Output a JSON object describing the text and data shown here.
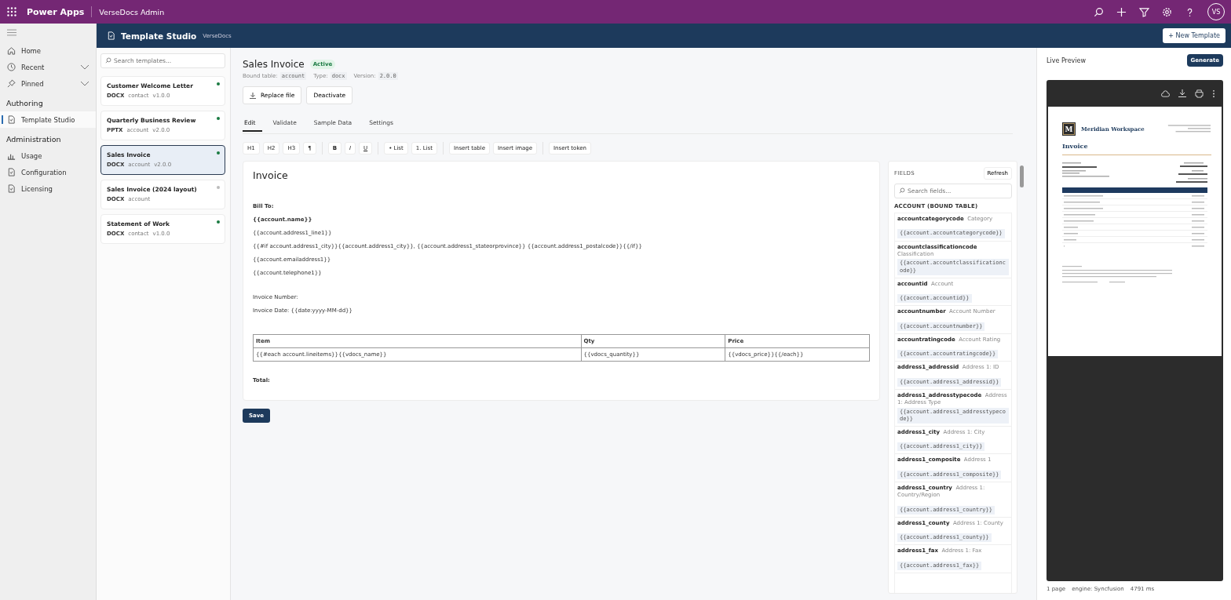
{
  "top_bar": {
    "app_name": "Power Apps",
    "environment": "VerseDocs Admin",
    "user_initials": "VS"
  },
  "nav": {
    "sections": [
      {
        "items": [
          {
            "label": "Home",
            "expandable": false,
            "selected": false
          },
          {
            "label": "Recent",
            "expandable": true,
            "selected": false
          },
          {
            "label": "Pinned",
            "expandable": true,
            "selected": false
          }
        ]
      },
      {
        "heading": "Authoring",
        "items": [
          {
            "label": "Template Studio",
            "expandable": false,
            "selected": true
          }
        ]
      },
      {
        "heading": "Administration",
        "items": [
          {
            "label": "Usage",
            "expandable": false,
            "selected": false
          },
          {
            "label": "Configuration",
            "expandable": false,
            "selected": false
          },
          {
            "label": "Licensing",
            "expandable": false,
            "selected": false
          }
        ]
      }
    ]
  },
  "studio_header": {
    "title": "Template Studio",
    "subtitle": "VerseDocs",
    "new_button": "+ New Template"
  },
  "templates": {
    "search_placeholder": "Search templates...",
    "items": [
      {
        "name": "Customer Welcome Letter",
        "format": "DOCX",
        "table": "contact",
        "version": "v1.0.0",
        "active": true,
        "selected": false
      },
      {
        "name": "Quarterly Business Review",
        "format": "PPTX",
        "table": "account",
        "version": "v2.0.0",
        "active": true,
        "selected": false
      },
      {
        "name": "Sales Invoice",
        "format": "DOCX",
        "table": "account",
        "version": "v2.0.0",
        "active": true,
        "selected": true
      },
      {
        "name": "Sales Invoice (2024 layout)",
        "format": "DOCX",
        "table": "account",
        "active": false,
        "selected": false
      },
      {
        "name": "Statement of Work",
        "format": "DOCX",
        "table": "contact",
        "version": "v1.0.0",
        "active": true,
        "selected": false
      }
    ]
  },
  "editor": {
    "title": "Sales Invoice",
    "status": "Active",
    "meta": [
      {
        "label": "Bound table:",
        "value": "account"
      },
      {
        "label": "Type:",
        "value": "docx"
      },
      {
        "label": "Version:",
        "value": "2.0.0"
      }
    ],
    "actions": [
      "Replace file",
      "Deactivate"
    ],
    "tabs": [
      {
        "label": "Edit",
        "selected": true
      },
      {
        "label": "Validate",
        "selected": false
      },
      {
        "label": "Sample Data",
        "selected": false
      },
      {
        "label": "Settings",
        "selected": false
      }
    ],
    "toolbar": [
      [
        "H1",
        "H2",
        "H3",
        "¶"
      ],
      [
        "B",
        "I",
        "U"
      ],
      [
        "• List",
        "1. List"
      ],
      [
        "Insert table",
        "Insert image"
      ],
      [
        "Insert token"
      ]
    ],
    "document": {
      "heading": "Invoice",
      "blocks": [
        {
          "kind": "gap"
        },
        {
          "kind": "bold",
          "text": "Bill To:"
        },
        {
          "kind": "bold",
          "text": "{{account.name}}"
        },
        {
          "kind": "plain",
          "text": "{{account.address1_line1}}"
        },
        {
          "kind": "plain",
          "text": "{{#if account.address1_city}}{{account.address1_city}}, {{account.address1_stateorprovince}} {{account.address1_postalcode}}{{/if}}"
        },
        {
          "kind": "plain",
          "text": "{{account.emailaddress1}}"
        },
        {
          "kind": "plain",
          "text": "{{account.telephone1}}"
        },
        {
          "kind": "gap"
        },
        {
          "kind": "plain",
          "text": "Invoice Number:"
        },
        {
          "kind": "plain",
          "text": "Invoice Date: {{date:yyyy-MM-dd}}"
        },
        {
          "kind": "gap"
        },
        {
          "kind": "table",
          "columns": [
            "Item",
            "Qty",
            "Price"
          ],
          "rows": [
            [
              "{{#each account.lineitems}}{{vdocs_name}}",
              "{{vdocs_quantity}}",
              "{{vdocs_price}}{{/each}}"
            ]
          ]
        },
        {
          "kind": "gap"
        },
        {
          "kind": "bold",
          "text": "Total:"
        }
      ]
    },
    "save": "Save"
  },
  "fields": {
    "title": "FIELDS",
    "refresh": "Refresh",
    "search_placeholder": "Search fields...",
    "group": "ACCOUNT (BOUND TABLE)",
    "items": [
      {
        "name": "accountcategorycode",
        "label": "Category",
        "token": "{{account.accountcategorycode}}"
      },
      {
        "name": "accountclassificationcode",
        "label": "Classification",
        "token": "{{account.accountclassificationcode}}"
      },
      {
        "name": "accountid",
        "label": "Account",
        "token": "{{account.accountid}}"
      },
      {
        "name": "accountnumber",
        "label": "Account Number",
        "token": "{{account.accountnumber}}"
      },
      {
        "name": "accountratingcode",
        "label": "Account Rating",
        "token": "{{account.accountratingcode}}"
      },
      {
        "name": "address1_addressid",
        "label": "Address 1: ID",
        "token": "{{account.address1_addressid}}"
      },
      {
        "name": "address1_addresstypecode",
        "label": "Address 1: Address Type",
        "token": "{{account.address1_addresstypecode}}"
      },
      {
        "name": "address1_city",
        "label": "Address 1: City",
        "token": "{{account.address1_city}}"
      },
      {
        "name": "address1_composite",
        "label": "Address 1",
        "token": "{{account.address1_composite}}"
      },
      {
        "name": "address1_country",
        "label": "Address 1: Country/Region",
        "token": "{{account.address1_country}}"
      },
      {
        "name": "address1_county",
        "label": "Address 1: County",
        "token": "{{account.address1_county}}"
      },
      {
        "name": "address1_fax",
        "label": "Address 1: Fax",
        "token": "{{account.address1_fax}}"
      }
    ]
  },
  "preview": {
    "title": "Live Preview",
    "generate": "Generate",
    "logo_letter": "M",
    "company": "Meridian Workspace",
    "doc_title": "Invoice",
    "footer": [
      "1 page",
      "engine: Syncfusion",
      "4791 ms"
    ]
  }
}
